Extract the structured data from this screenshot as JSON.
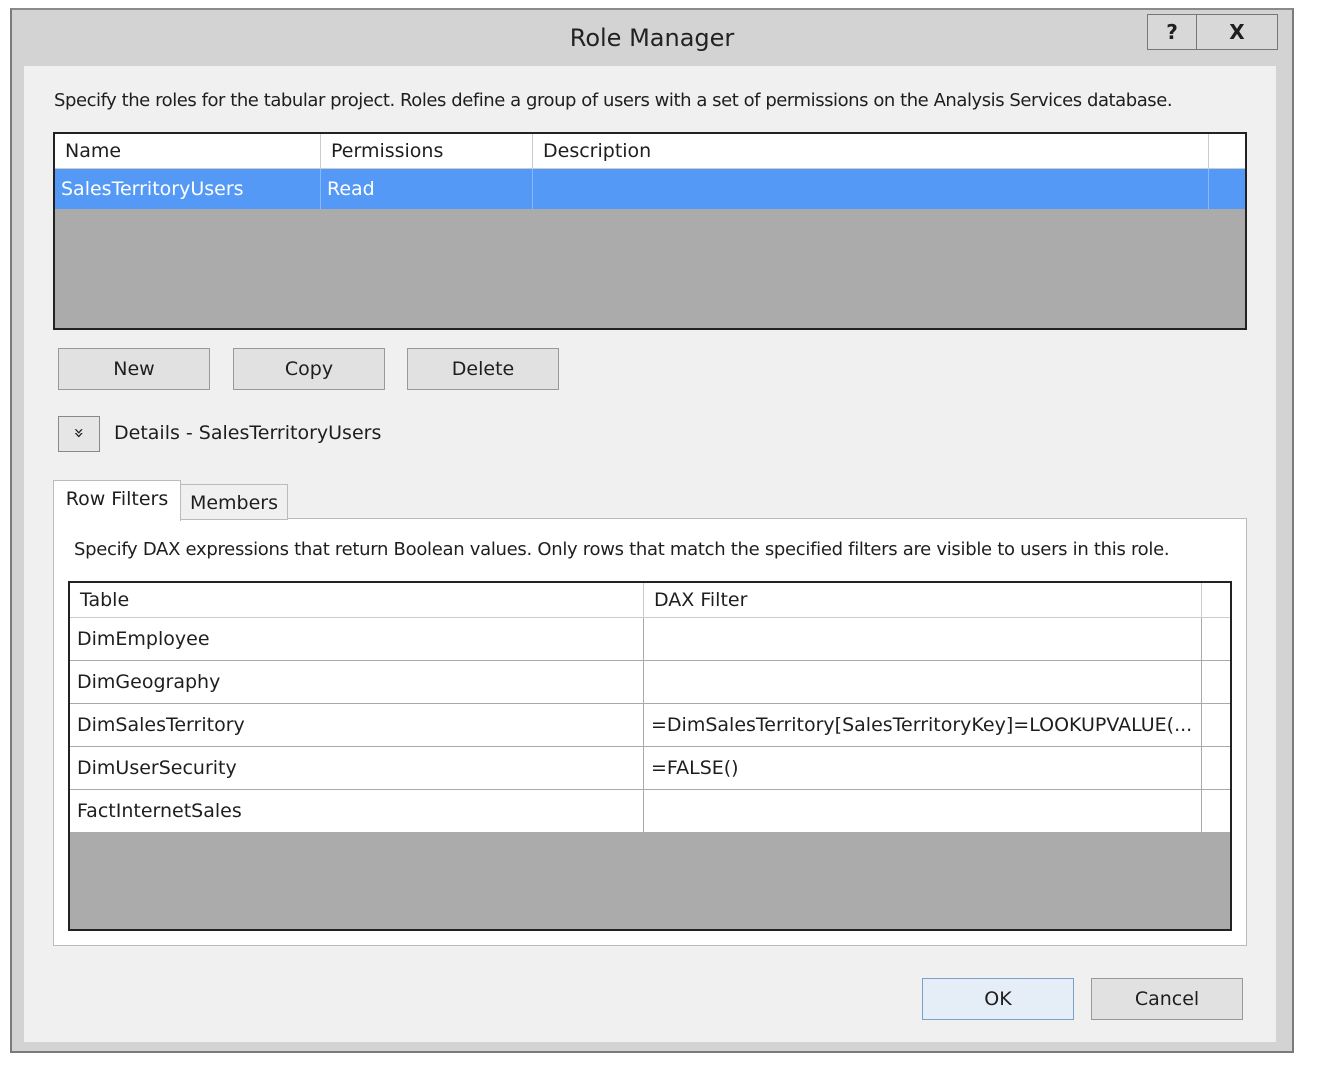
{
  "window": {
    "title": "Role Manager",
    "help": "?",
    "close": "X"
  },
  "intro": "Specify the roles for the tabular project. Roles define a group of users with a set of permissions on the Analysis Services database.",
  "roles": {
    "columns": [
      "Name",
      "Permissions",
      "Description"
    ],
    "rows": [
      {
        "name": "SalesTerritoryUsers",
        "permissions": "Read",
        "description": ""
      }
    ]
  },
  "buttons": {
    "new": "New",
    "copy": "Copy",
    "delete": "Delete",
    "ok": "OK",
    "cancel": "Cancel"
  },
  "details": {
    "label": "Details - SalesTerritoryUsers",
    "expander": "»"
  },
  "tabs": [
    "Row Filters",
    "Members"
  ],
  "row_filters": {
    "intro": "Specify DAX expressions that return Boolean values. Only rows that match the specified filters are visible to users in this role.",
    "columns": [
      "Table",
      "DAX Filter"
    ],
    "rows": [
      {
        "table": "DimEmployee",
        "filter": ""
      },
      {
        "table": "DimGeography",
        "filter": ""
      },
      {
        "table": "DimSalesTerritory",
        "filter": "=DimSalesTerritory[SalesTerritoryKey]=LOOKUPVALUE(..."
      },
      {
        "table": "DimUserSecurity",
        "filter": "=FALSE()"
      },
      {
        "table": "FactInternetSales",
        "filter": ""
      }
    ]
  },
  "colors": {
    "selection": "#5599f7",
    "grid_empty": "#ababab"
  }
}
